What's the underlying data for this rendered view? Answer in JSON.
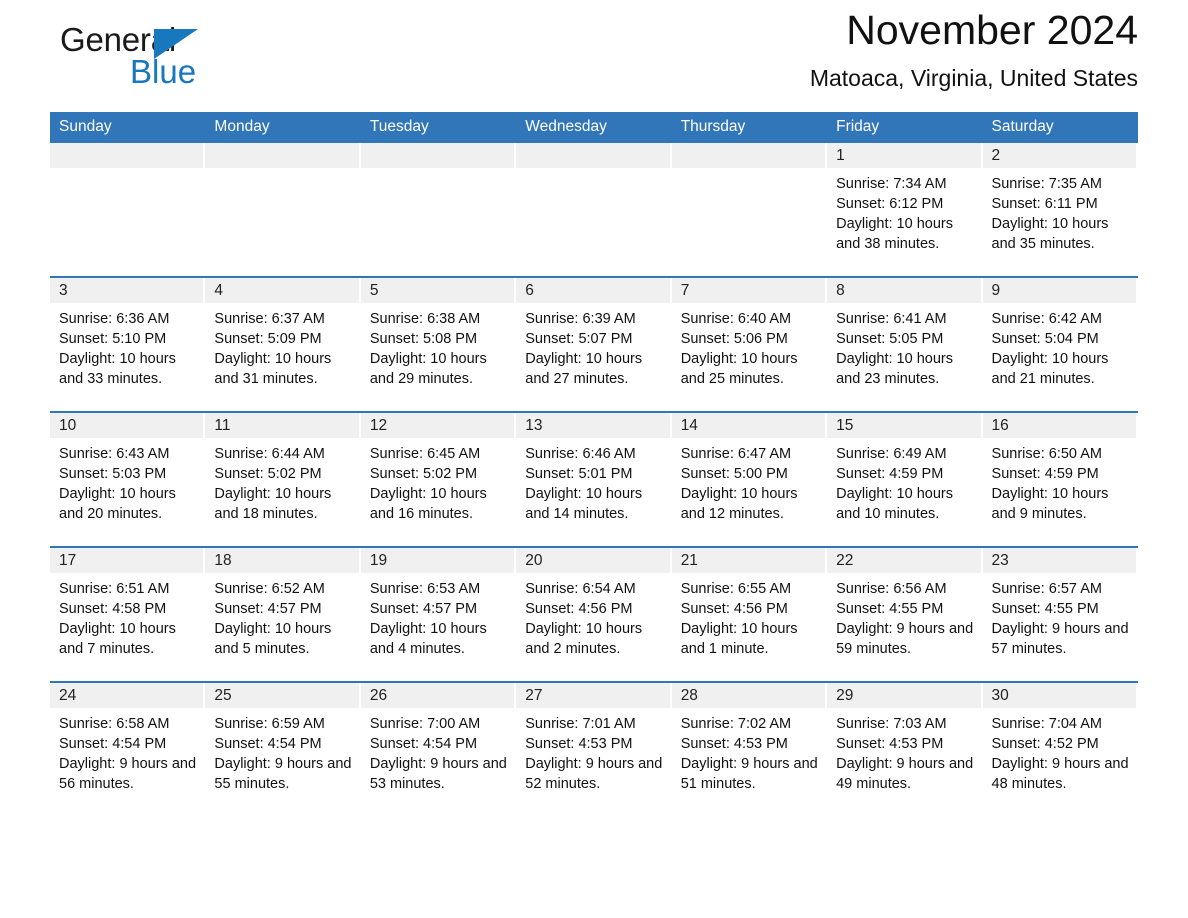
{
  "brand": {
    "name_part1": "General",
    "name_part2": "Blue",
    "logo_icon": "triangle-logo-icon"
  },
  "header": {
    "month_title": "November 2024",
    "location": "Matoaca, Virginia, United States"
  },
  "calendar": {
    "weekday_headers": [
      "Sunday",
      "Monday",
      "Tuesday",
      "Wednesday",
      "Thursday",
      "Friday",
      "Saturday"
    ],
    "accent_color": "#3176b8",
    "daynum_band_color": "#f0f0f0",
    "weeks": [
      [
        {
          "day": "",
          "sunrise": "",
          "sunset": "",
          "daylight": ""
        },
        {
          "day": "",
          "sunrise": "",
          "sunset": "",
          "daylight": ""
        },
        {
          "day": "",
          "sunrise": "",
          "sunset": "",
          "daylight": ""
        },
        {
          "day": "",
          "sunrise": "",
          "sunset": "",
          "daylight": ""
        },
        {
          "day": "",
          "sunrise": "",
          "sunset": "",
          "daylight": ""
        },
        {
          "day": "1",
          "sunrise": "Sunrise: 7:34 AM",
          "sunset": "Sunset: 6:12 PM",
          "daylight": "Daylight: 10 hours and 38 minutes."
        },
        {
          "day": "2",
          "sunrise": "Sunrise: 7:35 AM",
          "sunset": "Sunset: 6:11 PM",
          "daylight": "Daylight: 10 hours and 35 minutes."
        }
      ],
      [
        {
          "day": "3",
          "sunrise": "Sunrise: 6:36 AM",
          "sunset": "Sunset: 5:10 PM",
          "daylight": "Daylight: 10 hours and 33 minutes."
        },
        {
          "day": "4",
          "sunrise": "Sunrise: 6:37 AM",
          "sunset": "Sunset: 5:09 PM",
          "daylight": "Daylight: 10 hours and 31 minutes."
        },
        {
          "day": "5",
          "sunrise": "Sunrise: 6:38 AM",
          "sunset": "Sunset: 5:08 PM",
          "daylight": "Daylight: 10 hours and 29 minutes."
        },
        {
          "day": "6",
          "sunrise": "Sunrise: 6:39 AM",
          "sunset": "Sunset: 5:07 PM",
          "daylight": "Daylight: 10 hours and 27 minutes."
        },
        {
          "day": "7",
          "sunrise": "Sunrise: 6:40 AM",
          "sunset": "Sunset: 5:06 PM",
          "daylight": "Daylight: 10 hours and 25 minutes."
        },
        {
          "day": "8",
          "sunrise": "Sunrise: 6:41 AM",
          "sunset": "Sunset: 5:05 PM",
          "daylight": "Daylight: 10 hours and 23 minutes."
        },
        {
          "day": "9",
          "sunrise": "Sunrise: 6:42 AM",
          "sunset": "Sunset: 5:04 PM",
          "daylight": "Daylight: 10 hours and 21 minutes."
        }
      ],
      [
        {
          "day": "10",
          "sunrise": "Sunrise: 6:43 AM",
          "sunset": "Sunset: 5:03 PM",
          "daylight": "Daylight: 10 hours and 20 minutes."
        },
        {
          "day": "11",
          "sunrise": "Sunrise: 6:44 AM",
          "sunset": "Sunset: 5:02 PM",
          "daylight": "Daylight: 10 hours and 18 minutes."
        },
        {
          "day": "12",
          "sunrise": "Sunrise: 6:45 AM",
          "sunset": "Sunset: 5:02 PM",
          "daylight": "Daylight: 10 hours and 16 minutes."
        },
        {
          "day": "13",
          "sunrise": "Sunrise: 6:46 AM",
          "sunset": "Sunset: 5:01 PM",
          "daylight": "Daylight: 10 hours and 14 minutes."
        },
        {
          "day": "14",
          "sunrise": "Sunrise: 6:47 AM",
          "sunset": "Sunset: 5:00 PM",
          "daylight": "Daylight: 10 hours and 12 minutes."
        },
        {
          "day": "15",
          "sunrise": "Sunrise: 6:49 AM",
          "sunset": "Sunset: 4:59 PM",
          "daylight": "Daylight: 10 hours and 10 minutes."
        },
        {
          "day": "16",
          "sunrise": "Sunrise: 6:50 AM",
          "sunset": "Sunset: 4:59 PM",
          "daylight": "Daylight: 10 hours and 9 minutes."
        }
      ],
      [
        {
          "day": "17",
          "sunrise": "Sunrise: 6:51 AM",
          "sunset": "Sunset: 4:58 PM",
          "daylight": "Daylight: 10 hours and 7 minutes."
        },
        {
          "day": "18",
          "sunrise": "Sunrise: 6:52 AM",
          "sunset": "Sunset: 4:57 PM",
          "daylight": "Daylight: 10 hours and 5 minutes."
        },
        {
          "day": "19",
          "sunrise": "Sunrise: 6:53 AM",
          "sunset": "Sunset: 4:57 PM",
          "daylight": "Daylight: 10 hours and 4 minutes."
        },
        {
          "day": "20",
          "sunrise": "Sunrise: 6:54 AM",
          "sunset": "Sunset: 4:56 PM",
          "daylight": "Daylight: 10 hours and 2 minutes."
        },
        {
          "day": "21",
          "sunrise": "Sunrise: 6:55 AM",
          "sunset": "Sunset: 4:56 PM",
          "daylight": "Daylight: 10 hours and 1 minute."
        },
        {
          "day": "22",
          "sunrise": "Sunrise: 6:56 AM",
          "sunset": "Sunset: 4:55 PM",
          "daylight": "Daylight: 9 hours and 59 minutes."
        },
        {
          "day": "23",
          "sunrise": "Sunrise: 6:57 AM",
          "sunset": "Sunset: 4:55 PM",
          "daylight": "Daylight: 9 hours and 57 minutes."
        }
      ],
      [
        {
          "day": "24",
          "sunrise": "Sunrise: 6:58 AM",
          "sunset": "Sunset: 4:54 PM",
          "daylight": "Daylight: 9 hours and 56 minutes."
        },
        {
          "day": "25",
          "sunrise": "Sunrise: 6:59 AM",
          "sunset": "Sunset: 4:54 PM",
          "daylight": "Daylight: 9 hours and 55 minutes."
        },
        {
          "day": "26",
          "sunrise": "Sunrise: 7:00 AM",
          "sunset": "Sunset: 4:54 PM",
          "daylight": "Daylight: 9 hours and 53 minutes."
        },
        {
          "day": "27",
          "sunrise": "Sunrise: 7:01 AM",
          "sunset": "Sunset: 4:53 PM",
          "daylight": "Daylight: 9 hours and 52 minutes."
        },
        {
          "day": "28",
          "sunrise": "Sunrise: 7:02 AM",
          "sunset": "Sunset: 4:53 PM",
          "daylight": "Daylight: 9 hours and 51 minutes."
        },
        {
          "day": "29",
          "sunrise": "Sunrise: 7:03 AM",
          "sunset": "Sunset: 4:53 PM",
          "daylight": "Daylight: 9 hours and 49 minutes."
        },
        {
          "day": "30",
          "sunrise": "Sunrise: 7:04 AM",
          "sunset": "Sunset: 4:52 PM",
          "daylight": "Daylight: 9 hours and 48 minutes."
        }
      ]
    ]
  }
}
